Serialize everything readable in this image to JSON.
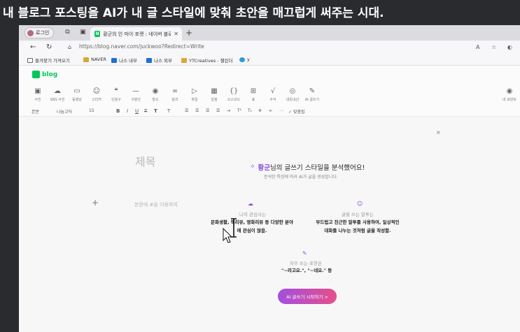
{
  "caption": "내 블로그 포스팅을 AI가 내 글 스타일에 맞춰 초안을 매끄럽게 써주는 시대.",
  "browser": {
    "profile_label": "로그인",
    "tab_title": "황군의 인 마이 포켓 : 네이버 블로그",
    "url": "https://blog.naver.com/juckwoo?Redirect=Write"
  },
  "bookmarks": [
    {
      "label": "즐겨찾기 가져오기",
      "icon": "folder-icon",
      "color": "#6b6b6b"
    },
    {
      "label": "NAVER",
      "icon": "folder-icon",
      "color": "#d8a83a"
    },
    {
      "label": "나스 내부",
      "icon": "nas-icon",
      "color": "#1f6fd6"
    },
    {
      "label": "나스 외부",
      "icon": "nas-icon",
      "color": "#1f6fd6"
    },
    {
      "label": "YTCreatives - 챌린더",
      "icon": "folder-icon",
      "color": "#d8a83a"
    },
    {
      "label": "y",
      "icon": "edge-icon",
      "color": "#2a9bd8"
    }
  ],
  "blog": {
    "logo": "blog"
  },
  "toolbar": [
    {
      "label": "사진",
      "icon": "photo-icon",
      "glyph": "▣"
    },
    {
      "label": "SNS 사진",
      "icon": "cloud-icon",
      "glyph": "☁"
    },
    {
      "label": "동영상",
      "icon": "video-icon",
      "glyph": "▭"
    },
    {
      "label": "스티커",
      "icon": "sticker-icon",
      "glyph": "☺"
    },
    {
      "label": "인용구",
      "icon": "quote-icon",
      "glyph": "❝"
    },
    {
      "label": "구분선",
      "icon": "divider-icon",
      "glyph": "—"
    },
    {
      "label": "장소",
      "icon": "location-icon",
      "glyph": "◉"
    },
    {
      "label": "링크",
      "icon": "link-icon",
      "glyph": "∞"
    },
    {
      "label": "파일",
      "icon": "file-icon",
      "glyph": "▷"
    },
    {
      "label": "일정",
      "icon": "calendar-icon",
      "glyph": "▦"
    },
    {
      "label": "소스코드",
      "icon": "code-icon",
      "glyph": "{}"
    },
    {
      "label": "표",
      "icon": "table-icon",
      "glyph": "⊞"
    },
    {
      "label": "수식",
      "icon": "formula-icon",
      "glyph": "√"
    },
    {
      "label": "내돈내산",
      "icon": "badge-icon",
      "glyph": "◎"
    },
    {
      "label": "AI 글쓰기",
      "icon": "ai-write-icon",
      "glyph": "✎"
    }
  ],
  "toolbar_right": {
    "label": "내 모먼트",
    "icon": "moment-icon",
    "glyph": "◉"
  },
  "format": {
    "style": "본문",
    "font": "나눔고딕",
    "size": "15",
    "spellcheck": "맞춤법"
  },
  "editor": {
    "title_placeholder": "제목",
    "body_placeholder": "본문에 #을 이용하여",
    "plus": "+"
  },
  "ai_panel": {
    "close": "×",
    "name": "황군",
    "title_rest": "님의 글쓰기 스타일을 분석했어요!",
    "subtitle": "분석한 특징에 따라 AI가 글을 생성합니다.",
    "interests_head": "나의 관심사는",
    "interests_line1": "문화생활, 책리뷰, 영화리뷰 등 다양한 분야",
    "interests_line2": "에 관심이 많음.",
    "tone_head": "글을 쓰는 말투는",
    "tone_line1": "부드럽고 친근한 말투를 사용하여, 일상적인",
    "tone_line2": "대화를 나누는 것처럼 글을 작성함.",
    "expr_head": "자주 쓰는 표현은",
    "expr_text": "\"~라고요.\", \"~네요.\" 등",
    "start_button": "AI 글쓰기 시작하기 >"
  },
  "accent": {
    "naver_green": "#03c75a",
    "ai_purple": "#8a4fd6",
    "ai_pink": "#e64f8a"
  }
}
